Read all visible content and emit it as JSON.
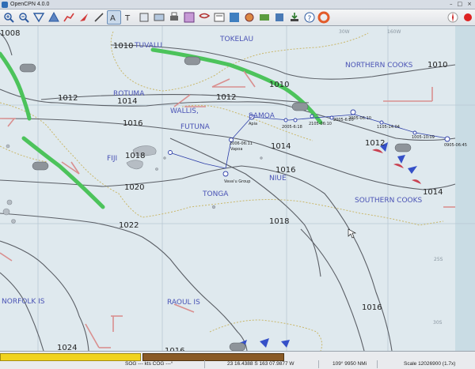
{
  "window": {
    "title": "OpenCPN 4.0.0",
    "minimize": "–",
    "maximize": "□",
    "close": "×"
  },
  "toolbar": {
    "tools": [
      {
        "name": "zoom-in-icon"
      },
      {
        "name": "zoom-out-icon"
      },
      {
        "name": "scale-down-icon"
      },
      {
        "name": "scale-up-icon"
      },
      {
        "name": "route-icon"
      },
      {
        "name": "follow-icon"
      },
      {
        "name": "measure-icon"
      },
      {
        "name": "ais-icon",
        "active": true
      },
      {
        "name": "show-currents-icon"
      },
      {
        "name": "show-tides-icon"
      },
      {
        "name": "print-icon"
      },
      {
        "name": "route-manager-icon"
      },
      {
        "name": "grib-icon"
      },
      {
        "name": "weather-fax-icon"
      },
      {
        "name": "dashboard-icon"
      },
      {
        "name": "track-icon"
      },
      {
        "name": "import-icon"
      },
      {
        "name": "export-icon"
      },
      {
        "name": "help-icon"
      },
      {
        "name": "man-overboard-icon"
      }
    ]
  },
  "map": {
    "regions": [
      "TUVALU",
      "TOKELAU",
      "NORTHERN COOKS",
      "ROTUMA",
      "WALLIS,",
      "FUTUNA",
      "SAMOA",
      "FIJI",
      "TONGA",
      "NIUE",
      "SOUTHERN COOKS",
      "NORFOLK IS",
      "RAOUL IS"
    ],
    "isobars": [
      "1010",
      "1012",
      "1014",
      "1016",
      "1018",
      "1020",
      "1022",
      "1024",
      "1016",
      "1018",
      "1016",
      "1012",
      "1014",
      "1010",
      "1008",
      "1014",
      "1012",
      "1016",
      "1010"
    ],
    "waypoints": [
      "Apia",
      "2005-6:18",
      "2105-06:10",
      "2005-6:20",
      "2005-06:10",
      "1105-14:04",
      "1005-10:09",
      "0905-06:45",
      "2006-06:11",
      "Vapoa",
      "Vava'u Group",
      "1018"
    ],
    "grid_labels": [
      "30W",
      "160W",
      "25S",
      "30S"
    ]
  },
  "status": {
    "sog": "SOG --- kts  COG ---°",
    "position": "23 16.4388 S   163 07.9877 W",
    "bearing": "109°   9950 NMi",
    "scale": "Scale 12026900 (1.7x)"
  },
  "colors": {
    "isobar": "#5b5f66",
    "front": "#4cc35b",
    "warm_front": "#d98f8f",
    "wind": "#c56a70",
    "label": "#4a53b5",
    "land": "#b6bdc4"
  }
}
